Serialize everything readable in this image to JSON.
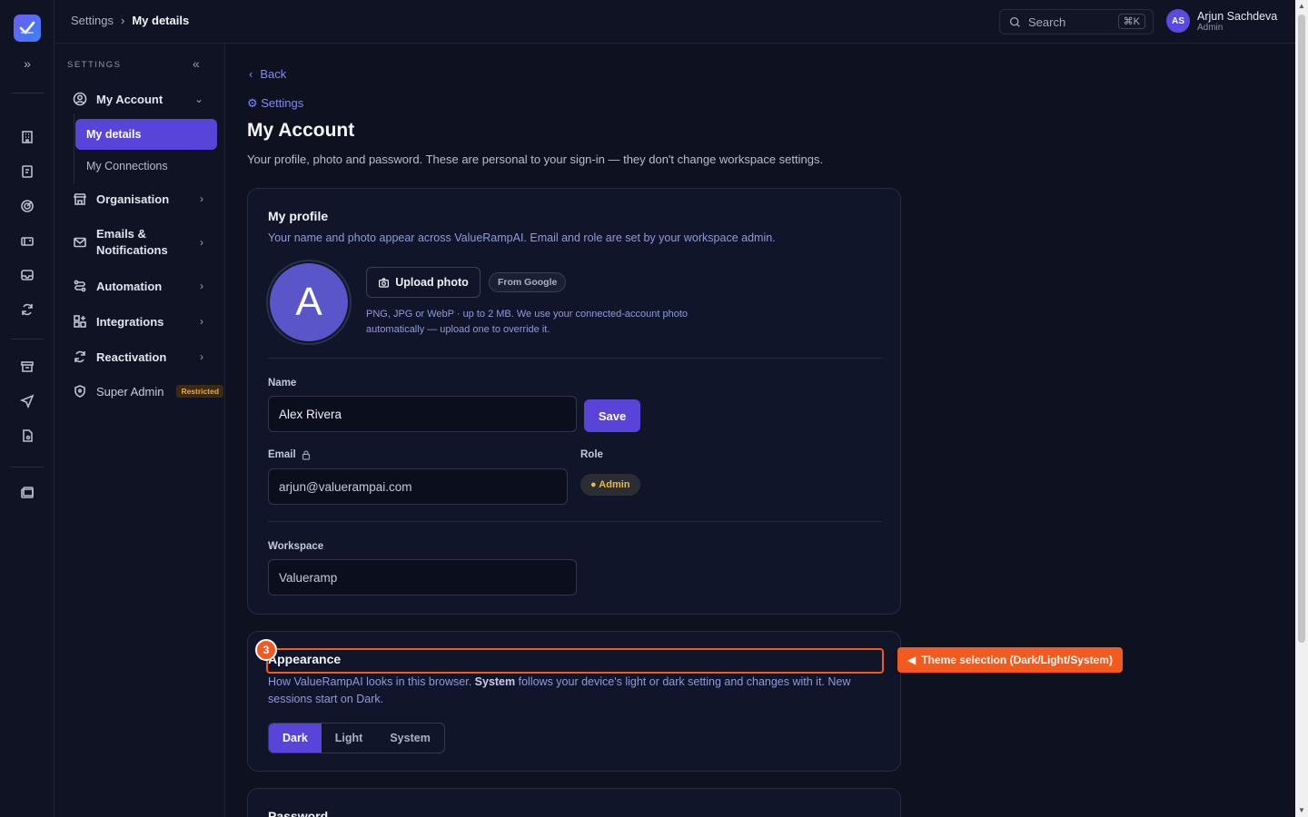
{
  "topbar": {
    "breadcrumb": [
      "Settings",
      "My details"
    ],
    "search_placeholder": "Search",
    "search_shortcut": "⌘K",
    "user": {
      "initials": "AS",
      "name": "Arjun Sachdeva",
      "role": "Admin"
    }
  },
  "sidebar": {
    "header": "SETTINGS",
    "my_account": "My Account",
    "sub_items": [
      "My details",
      "My Connections"
    ],
    "items": [
      "Organisation",
      "Emails &",
      "Notifications",
      "Automation",
      "Integrations",
      "Reactivation",
      "Super Admin"
    ],
    "restricted_badge": "Restricted"
  },
  "page": {
    "back": "Back",
    "settings_link": "⚙ Settings",
    "title": "My Account",
    "subtitle": "Your profile, photo and password. These are personal to your sign-in — they don't change workspace settings."
  },
  "profile": {
    "title": "My profile",
    "desc": "Your name and photo appear across ValueRampAI. Email and role are set by your workspace admin.",
    "avatar_letter": "A",
    "upload_label": "Upload photo",
    "from_google": "From Google",
    "hint": "PNG, JPG or WebP · up to 2 MB. We use your connected-account photo automatically — upload one to override it.",
    "name_label": "Name",
    "name_value": "Alex Rivera",
    "save_label": "Save",
    "email_label": "Email",
    "email_value": "arjun@valuerampai.com",
    "role_label": "Role",
    "role_value": "● Admin",
    "workspace_label": "Workspace",
    "workspace_value": "Valueramp"
  },
  "appearance": {
    "step": "3",
    "title": "Appearance",
    "desc_prefix": "How ValueRampAI looks in this browser.",
    "desc_bold": "System",
    "desc_suffix": "follows your device's light or dark setting and changes with it. New sessions start on Dark.",
    "options": [
      "Dark",
      "Light",
      "System"
    ],
    "selected": "Dark",
    "callout": "Theme selection (Dark/Light/System)"
  },
  "password": {
    "title": "Password"
  },
  "colors": {
    "accent": "#5844d8",
    "highlight": "#f25a1f",
    "background": "#0d1120"
  }
}
